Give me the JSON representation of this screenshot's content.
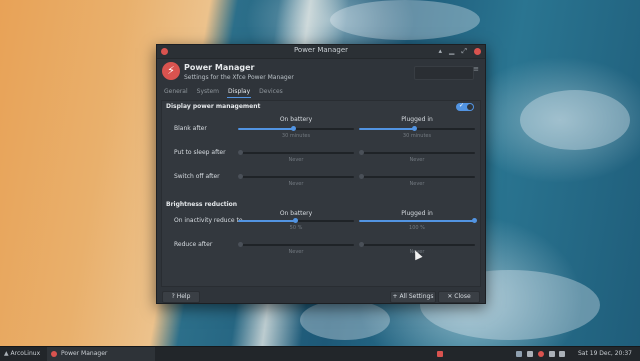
{
  "window": {
    "title": "Power Manager",
    "app_title": "Power Manager",
    "app_subtitle": "Settings for the Xfce Power Manager"
  },
  "tabs": [
    {
      "label": "General",
      "active": false
    },
    {
      "label": "System",
      "active": false
    },
    {
      "label": "Display",
      "active": true
    },
    {
      "label": "Devices",
      "active": false
    }
  ],
  "display_pm": {
    "heading": "Display power management",
    "enabled": true,
    "col_battery": "On battery",
    "col_plugged": "Plugged in",
    "rows": [
      {
        "label": "Blank after",
        "battery_value": "30 minutes",
        "plugged_value": "30 minutes",
        "battery_level": 0.48,
        "plugged_level": 0.48
      },
      {
        "label": "Put to sleep after",
        "battery_value": "Never",
        "plugged_value": "Never",
        "battery_level": 0,
        "plugged_level": 0
      },
      {
        "label": "Switch off after",
        "battery_value": "Never",
        "plugged_value": "Never",
        "battery_level": 0,
        "plugged_level": 0
      }
    ]
  },
  "brightness": {
    "heading": "Brightness reduction",
    "col_battery": "On battery",
    "col_plugged": "Plugged in",
    "rows": [
      {
        "label": "On inactivity reduce to",
        "battery_value": "50 %",
        "plugged_value": "100 %",
        "battery_level": 0.5,
        "plugged_level": 1.0
      },
      {
        "label": "Reduce after",
        "battery_value": "Never",
        "plugged_value": "Never",
        "battery_level": 0,
        "plugged_level": 0
      }
    ]
  },
  "footer": {
    "help_label": "Help",
    "all_settings_label": "All Settings",
    "close_label": "Close"
  },
  "taskbar": {
    "menu_label": "ArcoLinux",
    "task_label": "Power Manager",
    "clock": "Sat 19 Dec, 20:37"
  },
  "colors": {
    "accent": "#5294e2",
    "danger": "#d9534f",
    "window_bg": "#2f343a"
  }
}
